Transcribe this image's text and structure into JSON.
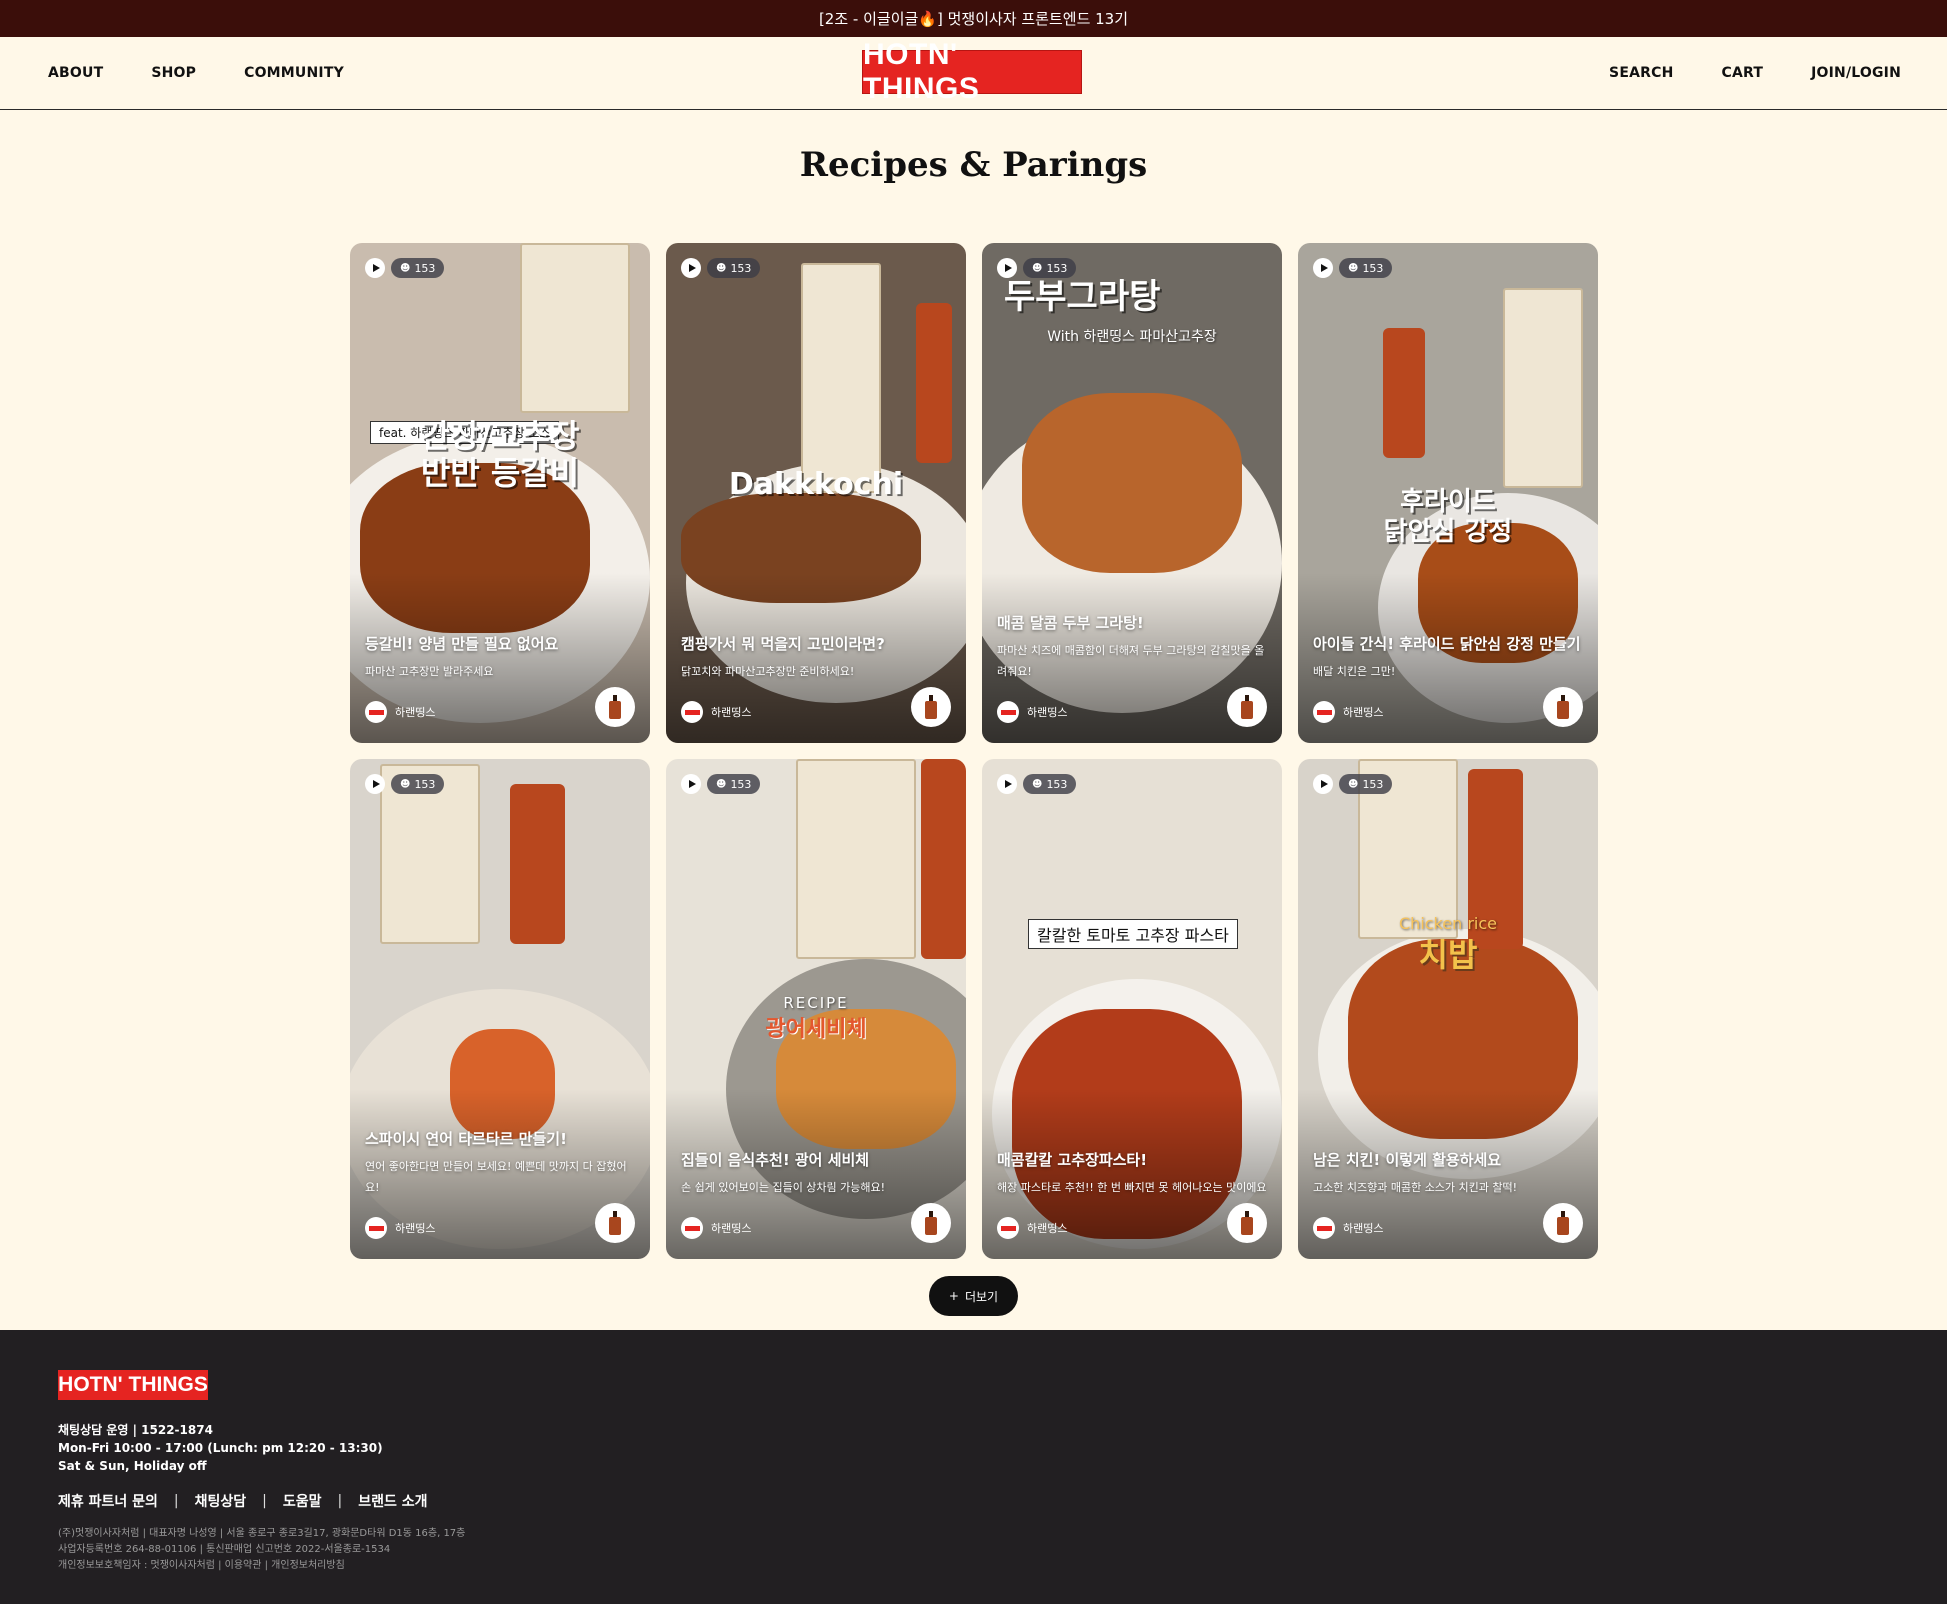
{
  "topbar": {
    "text": "[2조 - 이글이글🔥] 멋쟁이사자 프론트엔드 13기"
  },
  "nav": {
    "left": [
      "ABOUT",
      "SHOP",
      "COMMUNITY"
    ],
    "right": [
      "SEARCH",
      "CART",
      "JOIN/LOGIN"
    ],
    "logo": "HOTN' THINGS"
  },
  "page_title": "Recipes & Parings",
  "cards": [
    {
      "views": "153",
      "overlay_tag": "feat. 하랜띵스 파마산고추장 소스",
      "overlay_title": "간장/고추장\n반반 등갈비",
      "title": "등갈비! 양념 만들 필요 없어요",
      "description": "파마산 고추장만 발라주세요",
      "author": "하랜띵스",
      "colors": {
        "bg": "#c9bcae",
        "plate": "#f3efe9",
        "food": "#8a3d15"
      }
    },
    {
      "views": "153",
      "overlay_title": "Dakkkochi",
      "title": "캠핑가서 뭐 먹을지 고민이라면?",
      "description": "닭꼬치와 파마산고추장만 준비하세요!",
      "author": "하랜띵스",
      "colors": {
        "bg": "#6b5a4c",
        "plate": "#ece7df",
        "food": "#7a4220"
      }
    },
    {
      "views": "153",
      "overlay_title": "두부그라탕",
      "overlay_sub": "With 하랜띵스 파마산고추장",
      "title": "매콤 달콤 두부 그라탕!",
      "description": "파마산 치즈에 매콤함이 더해져 두부 그라탕의 감칠맛을 올려줘요!",
      "author": "하랜띵스",
      "colors": {
        "bg": "#6f6a63",
        "plate": "#efeae2",
        "food": "#b8652c"
      }
    },
    {
      "views": "153",
      "overlay_title": "후라이드\n닭안심 강정",
      "title": "아이들 간식! 후라이드 닭안심 강정 만들기",
      "description": "배달 치킨은 그만!",
      "author": "하랜띵스",
      "colors": {
        "bg": "#a9a59c",
        "plate": "#e9e6e2",
        "food": "#a84d18"
      }
    },
    {
      "views": "153",
      "title": "스파이시 연어 타르타르 만들기!",
      "description": "연어 좋아한다면 만들어 보세요! 예쁜데 맛까지 다 잡혔어요!",
      "author": "하랜띵스",
      "colors": {
        "bg": "#d9d4cc",
        "plate": "#e8e1d6",
        "food": "#d8622a"
      }
    },
    {
      "views": "153",
      "overlay_sub": "RECIPE",
      "overlay_title": "광어세비체",
      "title": "집들이 음식추천! 광어 세비체",
      "description": "손 쉽게 있어보이는 집들이 상차림 가능해요!",
      "author": "하랜띵스",
      "colors": {
        "bg": "#e7e2d8",
        "plate": "#9c9890",
        "food": "#d68a3a"
      }
    },
    {
      "views": "153",
      "overlay_tag": "칼칼한 토마토 고추장 파스타",
      "title": "매콤칼칼 고추장파스타!",
      "description": "해장 파스타로 추천!! 한 번 빠지면 못 헤어나오는 맛이에요",
      "author": "하랜띵스",
      "colors": {
        "bg": "#e6e0d5",
        "plate": "#f4f1ec",
        "food": "#b23c1a"
      }
    },
    {
      "views": "153",
      "overlay_sub": "Chicken rice",
      "overlay_title": "치밥",
      "title": "남은 치킨! 이렇게 활용하세요",
      "description": "고소한 치즈향과 매콤한 소스가 치킨과 찰떡!",
      "author": "하랜띵스",
      "colors": {
        "bg": "#d8d3ca",
        "plate": "#f2efe9",
        "food": "#b24a1c"
      }
    }
  ],
  "more_button": {
    "icon": "+",
    "label": "더보기"
  },
  "footer": {
    "logo": "HOTN' THINGS",
    "info": [
      "채팅상담 운영  |  1522-1874",
      "Mon-Fri 10:00 - 17:00 (Lunch: pm 12:20 - 13:30)",
      "Sat & Sun, Holiday off"
    ],
    "links": [
      "제휴 파트너 문의",
      "채팅상담",
      "도움말",
      "브랜드 소개"
    ],
    "legal": [
      "(주)멋쟁이사자처럼  |  대표자명 나성영  |  서울 종로구 종로3길17, 광화문D타워 D1동 16층, 17층",
      "사업자등록번호 264-88-01106 | 통신판매업 신고번호 2022-서울종로-1534",
      "개인정보보호책임자 : 멋쟁이사자처럼  |  이용약관  |  개인정보처리방침"
    ]
  }
}
